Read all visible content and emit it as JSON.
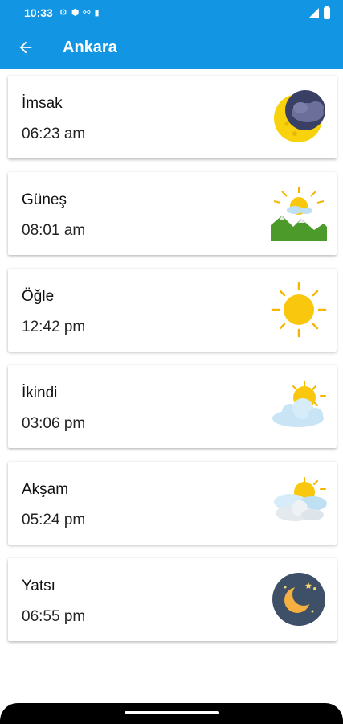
{
  "status_bar": {
    "time": "10:33"
  },
  "app_bar": {
    "title": "Ankara"
  },
  "prayer_times": [
    {
      "name": "İmsak",
      "time": "06:23 am",
      "icon": "moon-cloud-icon"
    },
    {
      "name": "Güneş",
      "time": "08:01 am",
      "icon": "sunrise-mountains-icon"
    },
    {
      "name": "Öğle",
      "time": "12:42 pm",
      "icon": "sun-icon"
    },
    {
      "name": "İkindi",
      "time": "03:06 pm",
      "icon": "sun-behind-cloud-icon"
    },
    {
      "name": "Akşam",
      "time": "05:24 pm",
      "icon": "sun-behind-clouds-icon"
    },
    {
      "name": "Yatsı",
      "time": "06:55 pm",
      "icon": "night-moon-icon"
    }
  ],
  "colors": {
    "primary": "#1295e3",
    "sun": "#f9c80e",
    "sun_rays": "#f7b500",
    "cloud": "#d3e9f5",
    "night": "#3e4f68"
  }
}
